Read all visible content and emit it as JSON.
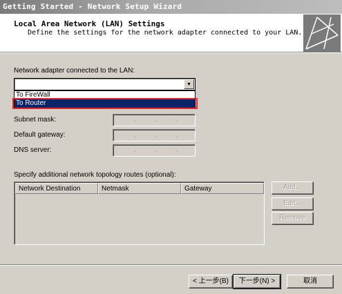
{
  "window": {
    "title": "Getting Started - Network Setup Wizard"
  },
  "header": {
    "title": "Local Area Network (LAN) Settings",
    "subtitle": "Define the settings for the network adapter connected to your LAN."
  },
  "adapter": {
    "label": "Network adapter connected to the LAN:",
    "value": "",
    "options": [
      "To FireWall",
      "To Router"
    ],
    "highlighted_option": "To Router"
  },
  "fields": {
    "subnet_label": "Subnet mask:",
    "gateway_label": "Default gateway:",
    "dns_label": "DNS server:",
    "ip_dots": [
      ".",
      " .",
      "."
    ]
  },
  "routes": {
    "label": "Specify additional network topology routes (optional):",
    "columns": [
      "Network Destination",
      "Netmask",
      "Gateway"
    ],
    "rows": []
  },
  "route_buttons": {
    "add": "Add...",
    "edit": "Edit...",
    "remove": "Remove"
  },
  "nav": {
    "back": "< 上一步(B)",
    "next": "下一步(N) >",
    "cancel": "取消"
  }
}
